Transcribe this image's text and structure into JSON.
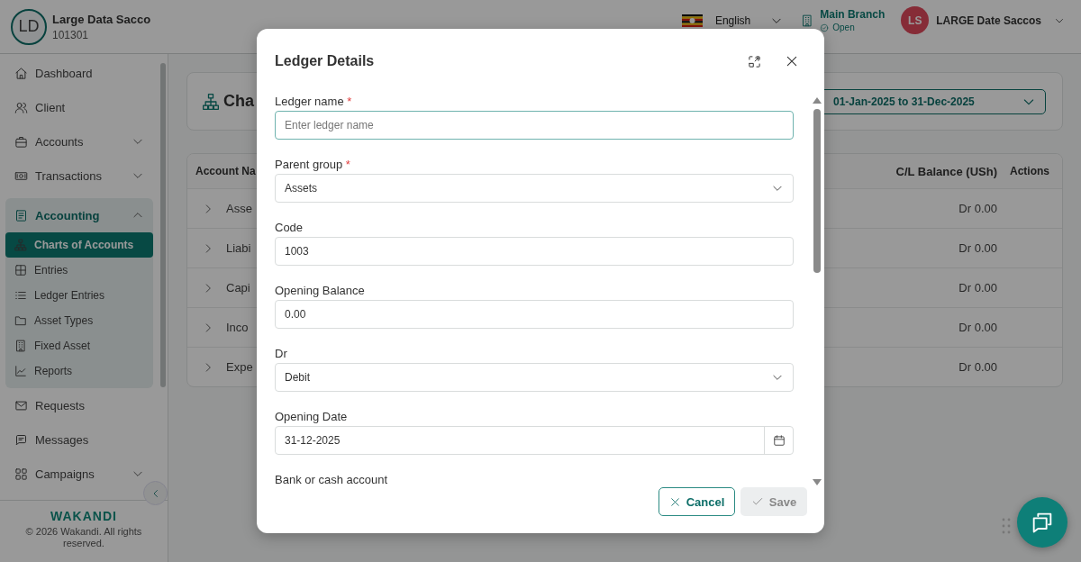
{
  "header": {
    "org": {
      "initials": "LD",
      "name": "Large Data Sacco",
      "code": "101301"
    },
    "language": {
      "label": "English"
    },
    "branch": {
      "name": "Main Branch",
      "status": "Open"
    },
    "user": {
      "initials": "LS",
      "name": "LARGE Date Saccos"
    }
  },
  "sidebar": {
    "items": [
      {
        "label": "Dashboard",
        "selected": false
      },
      {
        "label": "Client",
        "selected": false
      },
      {
        "label": "Accounts",
        "selected": false,
        "expanded": false
      },
      {
        "label": "Transactions",
        "selected": false,
        "expanded": false
      },
      {
        "label": "Accounting",
        "selected": false,
        "expanded": true,
        "children": [
          {
            "label": "Charts of Accounts",
            "selected": true
          },
          {
            "label": "Entries",
            "selected": false
          },
          {
            "label": "Ledger Entries",
            "selected": false
          },
          {
            "label": "Asset Types",
            "selected": false
          },
          {
            "label": "Fixed Asset",
            "selected": false
          },
          {
            "label": "Reports",
            "selected": false
          }
        ]
      },
      {
        "label": "Requests",
        "selected": false
      },
      {
        "label": "Messages",
        "selected": false
      },
      {
        "label": "Campaigns",
        "selected": false,
        "expanded": false
      }
    ],
    "logo": "WAKANDI",
    "copyright": "© 2026 Wakandi. All rights reserved."
  },
  "page": {
    "title": "Cha",
    "date_range": "01-Jan-2025 to 31-Dec-2025"
  },
  "table": {
    "columns": [
      "Account Na",
      "C/L Balance (USh)",
      "Actions"
    ],
    "rows": [
      {
        "name": "Asse",
        "balance": "Dr 0.00",
        "expanded": false
      },
      {
        "name": "Liabi",
        "balance": "Dr 0.00",
        "expanded": false
      },
      {
        "name": "Capi",
        "balance": "Dr 0.00",
        "expanded": false
      },
      {
        "name": "Inco",
        "balance": "Dr 0.00",
        "expanded": false
      },
      {
        "name": "Expe",
        "balance": "Dr 0.00",
        "expanded": false
      }
    ]
  },
  "modal": {
    "title": "Ledger Details",
    "fields": [
      {
        "label": "Ledger name",
        "required_mark": "*",
        "kind": "text",
        "placeholder": "Enter ledger name",
        "focused": true
      },
      {
        "label": "Parent group",
        "required_mark": "*",
        "kind": "select",
        "value": "Assets"
      },
      {
        "label": "Code",
        "kind": "text",
        "value": "1003"
      },
      {
        "label": "Opening Balance",
        "kind": "text",
        "value": "0.00"
      },
      {
        "label": "Dr",
        "kind": "select",
        "value": "Debit"
      },
      {
        "label": "Opening Date",
        "kind": "date",
        "value": "31-12-2025"
      },
      {
        "label": "Bank or cash account"
      }
    ],
    "buttons": [
      {
        "label": "Cancel",
        "kind": "cancel",
        "disabled": false
      },
      {
        "label": "Save",
        "kind": "save",
        "disabled": true
      }
    ]
  }
}
